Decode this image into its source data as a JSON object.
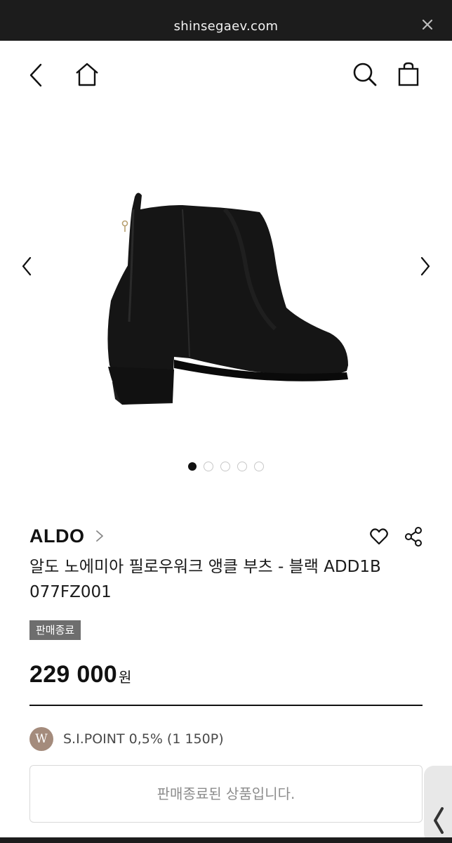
{
  "browser": {
    "url": "shinsegaev.com",
    "close_icon": "close-icon"
  },
  "nav": {
    "back_icon": "chevron-left-icon",
    "home_icon": "home-icon",
    "search_icon": "search-icon",
    "cart_icon": "shopping-bag-icon"
  },
  "gallery": {
    "image": "black-ankle-boot",
    "total_images": 5,
    "active_index": 0,
    "prev_icon": "chevron-left-icon",
    "next_icon": "chevron-right-icon"
  },
  "product": {
    "brand": "ALDO",
    "title": "알도 노에미아 필로우워크 앵클 부츠 - 블랙 ADD1B 077FZ001",
    "status_badge": "판매종료",
    "price": "229 000",
    "currency": "원",
    "wishlist_icon": "heart-icon",
    "share_icon": "share-icon"
  },
  "points": {
    "logo_letter": "W",
    "text": "S.I.POINT 0,5% (1 150P)"
  },
  "purchase": {
    "sold_out_message": "판매종료된 상품입니다."
  },
  "colors": {
    "browser_bar": "#1c1c1c",
    "badge": "#6e6e6e",
    "points_logo": "#a48b7c",
    "text": "#111111"
  }
}
